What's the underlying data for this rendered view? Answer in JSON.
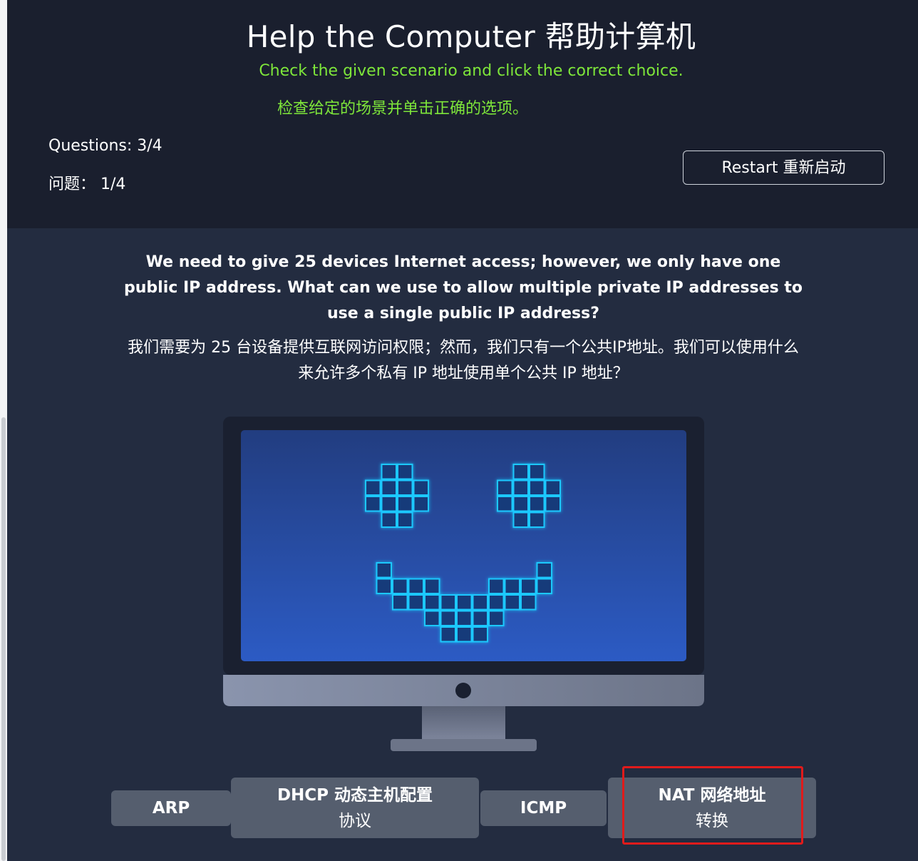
{
  "header": {
    "title": "Help the Computer 帮助计算机",
    "instruction_en": "Check the given scenario and click the correct choice.",
    "instruction_zh": "检查给定的场景并单击正确的选项。",
    "questions_en": "Questions: 3/4",
    "questions_zh": "问题： 1/4",
    "restart_label": "Restart 重新启动"
  },
  "question": {
    "text_en": "We need to give 25 devices Internet access; however, we only have one public IP address. What can we use to allow multiple private IP addresses to use a single public IP address?",
    "text_zh": "我们需要为 25 台设备提供互联网访问权限；然而，我们只有一个公共IP地址。我们可以使用什么来允许多个私有 IP 地址使用单个公共 IP 地址？"
  },
  "choices": [
    {
      "line1": "ARP",
      "line2": ""
    },
    {
      "line1": "DHCP 动态主机配置",
      "line2": "协议"
    },
    {
      "line1": "ICMP",
      "line2": ""
    },
    {
      "line1": "NAT 网络地址",
      "line2": "转换"
    }
  ],
  "colors": {
    "header_bg": "#1a1f2e",
    "main_bg": "#232c40",
    "accent_green": "#7ee63a",
    "choice_bg": "#555e6e",
    "screen_pixel": "#1ec8ff",
    "highlight": "#e01b1b"
  },
  "icons": [
    "smiley-computer-illustration"
  ]
}
